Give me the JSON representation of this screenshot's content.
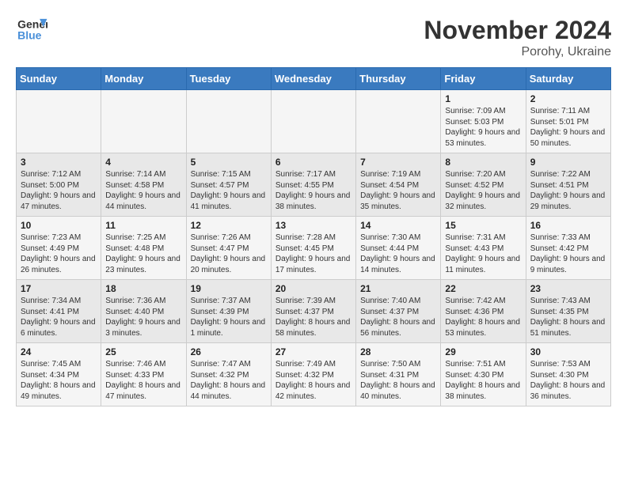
{
  "logo": {
    "line1": "General",
    "line2": "Blue"
  },
  "title": "November 2024",
  "subtitle": "Porohy, Ukraine",
  "header_days": [
    "Sunday",
    "Monday",
    "Tuesday",
    "Wednesday",
    "Thursday",
    "Friday",
    "Saturday"
  ],
  "weeks": [
    [
      {
        "day": "",
        "info": ""
      },
      {
        "day": "",
        "info": ""
      },
      {
        "day": "",
        "info": ""
      },
      {
        "day": "",
        "info": ""
      },
      {
        "day": "",
        "info": ""
      },
      {
        "day": "1",
        "info": "Sunrise: 7:09 AM\nSunset: 5:03 PM\nDaylight: 9 hours\nand 53 minutes."
      },
      {
        "day": "2",
        "info": "Sunrise: 7:11 AM\nSunset: 5:01 PM\nDaylight: 9 hours\nand 50 minutes."
      }
    ],
    [
      {
        "day": "3",
        "info": "Sunrise: 7:12 AM\nSunset: 5:00 PM\nDaylight: 9 hours\nand 47 minutes."
      },
      {
        "day": "4",
        "info": "Sunrise: 7:14 AM\nSunset: 4:58 PM\nDaylight: 9 hours\nand 44 minutes."
      },
      {
        "day": "5",
        "info": "Sunrise: 7:15 AM\nSunset: 4:57 PM\nDaylight: 9 hours\nand 41 minutes."
      },
      {
        "day": "6",
        "info": "Sunrise: 7:17 AM\nSunset: 4:55 PM\nDaylight: 9 hours\nand 38 minutes."
      },
      {
        "day": "7",
        "info": "Sunrise: 7:19 AM\nSunset: 4:54 PM\nDaylight: 9 hours\nand 35 minutes."
      },
      {
        "day": "8",
        "info": "Sunrise: 7:20 AM\nSunset: 4:52 PM\nDaylight: 9 hours\nand 32 minutes."
      },
      {
        "day": "9",
        "info": "Sunrise: 7:22 AM\nSunset: 4:51 PM\nDaylight: 9 hours\nand 29 minutes."
      }
    ],
    [
      {
        "day": "10",
        "info": "Sunrise: 7:23 AM\nSunset: 4:49 PM\nDaylight: 9 hours\nand 26 minutes."
      },
      {
        "day": "11",
        "info": "Sunrise: 7:25 AM\nSunset: 4:48 PM\nDaylight: 9 hours\nand 23 minutes."
      },
      {
        "day": "12",
        "info": "Sunrise: 7:26 AM\nSunset: 4:47 PM\nDaylight: 9 hours\nand 20 minutes."
      },
      {
        "day": "13",
        "info": "Sunrise: 7:28 AM\nSunset: 4:45 PM\nDaylight: 9 hours\nand 17 minutes."
      },
      {
        "day": "14",
        "info": "Sunrise: 7:30 AM\nSunset: 4:44 PM\nDaylight: 9 hours\nand 14 minutes."
      },
      {
        "day": "15",
        "info": "Sunrise: 7:31 AM\nSunset: 4:43 PM\nDaylight: 9 hours\nand 11 minutes."
      },
      {
        "day": "16",
        "info": "Sunrise: 7:33 AM\nSunset: 4:42 PM\nDaylight: 9 hours\nand 9 minutes."
      }
    ],
    [
      {
        "day": "17",
        "info": "Sunrise: 7:34 AM\nSunset: 4:41 PM\nDaylight: 9 hours\nand 6 minutes."
      },
      {
        "day": "18",
        "info": "Sunrise: 7:36 AM\nSunset: 4:40 PM\nDaylight: 9 hours\nand 3 minutes."
      },
      {
        "day": "19",
        "info": "Sunrise: 7:37 AM\nSunset: 4:39 PM\nDaylight: 9 hours\nand 1 minute."
      },
      {
        "day": "20",
        "info": "Sunrise: 7:39 AM\nSunset: 4:37 PM\nDaylight: 8 hours\nand 58 minutes."
      },
      {
        "day": "21",
        "info": "Sunrise: 7:40 AM\nSunset: 4:37 PM\nDaylight: 8 hours\nand 56 minutes."
      },
      {
        "day": "22",
        "info": "Sunrise: 7:42 AM\nSunset: 4:36 PM\nDaylight: 8 hours\nand 53 minutes."
      },
      {
        "day": "23",
        "info": "Sunrise: 7:43 AM\nSunset: 4:35 PM\nDaylight: 8 hours\nand 51 minutes."
      }
    ],
    [
      {
        "day": "24",
        "info": "Sunrise: 7:45 AM\nSunset: 4:34 PM\nDaylight: 8 hours\nand 49 minutes."
      },
      {
        "day": "25",
        "info": "Sunrise: 7:46 AM\nSunset: 4:33 PM\nDaylight: 8 hours\nand 47 minutes."
      },
      {
        "day": "26",
        "info": "Sunrise: 7:47 AM\nSunset: 4:32 PM\nDaylight: 8 hours\nand 44 minutes."
      },
      {
        "day": "27",
        "info": "Sunrise: 7:49 AM\nSunset: 4:32 PM\nDaylight: 8 hours\nand 42 minutes."
      },
      {
        "day": "28",
        "info": "Sunrise: 7:50 AM\nSunset: 4:31 PM\nDaylight: 8 hours\nand 40 minutes."
      },
      {
        "day": "29",
        "info": "Sunrise: 7:51 AM\nSunset: 4:30 PM\nDaylight: 8 hours\nand 38 minutes."
      },
      {
        "day": "30",
        "info": "Sunrise: 7:53 AM\nSunset: 4:30 PM\nDaylight: 8 hours\nand 36 minutes."
      }
    ]
  ]
}
